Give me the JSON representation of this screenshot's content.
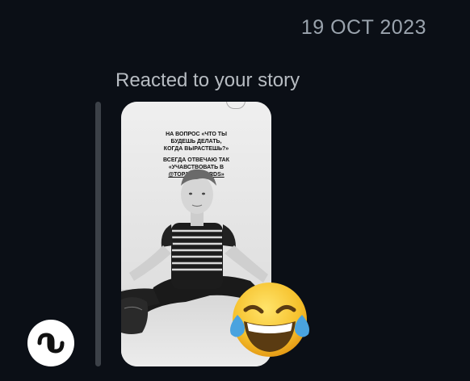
{
  "header": {
    "date": "19 OCT 2023"
  },
  "message": {
    "reaction_caption": "Reacted to your story"
  },
  "story": {
    "line1": "НА ВОПРОС «ЧТО ТЫ",
    "line2": "БУДЕШЬ ДЕЛАТЬ,",
    "line3": "КОГДА ВЫРАСТЕШЬ?»",
    "line4": "ВСЕГДА ОТВЕЧАЮ ТАК",
    "line5": "«УЧАВСТВОВАТЬ В",
    "line6": "@TOP100.AWARDS»"
  },
  "reaction": {
    "emoji_name": "face-with-tears-of-joy-icon"
  },
  "colors": {
    "background": "#0b0f16",
    "emoji_yellow": "#f7c42e",
    "tear_blue": "#4aa3df"
  }
}
